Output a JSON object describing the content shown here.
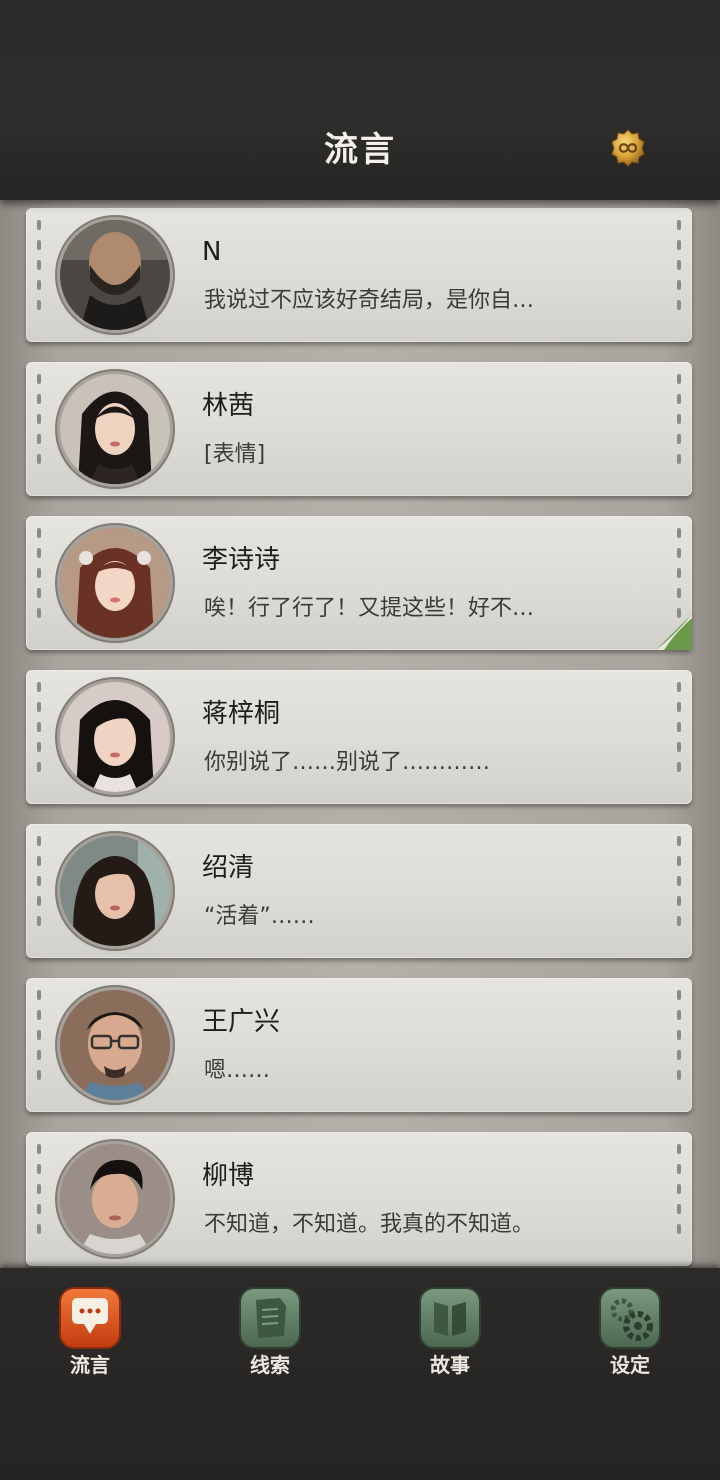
{
  "header": {
    "title": "流言",
    "coin_icon": "gold-infinity-coin-icon"
  },
  "chats": [
    {
      "name": "N",
      "message": "我说过不应该好奇结局，是你自…",
      "avatar_icon": "man-bearded-avatar"
    },
    {
      "name": "林茜",
      "message": "[表情]",
      "avatar_icon": "woman-long-hair-avatar"
    },
    {
      "name": "李诗诗",
      "message": "唉！行了行了！又提这些！好不…",
      "avatar_icon": "woman-hair-clips-avatar"
    },
    {
      "name": "蒋梓桐",
      "message": "你别说了……别说了…………",
      "avatar_icon": "woman-dark-hair-avatar"
    },
    {
      "name": "绍清",
      "message": "“活着”……",
      "avatar_icon": "woman-wavy-hair-avatar"
    },
    {
      "name": "王广兴",
      "message": "嗯……",
      "avatar_icon": "man-glasses-avatar"
    },
    {
      "name": "柳博",
      "message": "不知道，不知道。我真的不知道。",
      "avatar_icon": "young-man-avatar"
    }
  ],
  "tabs": [
    {
      "label": "流言",
      "icon": "chat-bubble-icon",
      "active": true
    },
    {
      "label": "线索",
      "icon": "paper-scroll-icon",
      "active": false
    },
    {
      "label": "故事",
      "icon": "book-icon",
      "active": false
    },
    {
      "label": "设定",
      "icon": "gear-icon",
      "active": false
    }
  ],
  "colors": {
    "active_tab": "#e5581f",
    "inactive_tab": "#5f7a63",
    "coin": "#d9a23a"
  }
}
